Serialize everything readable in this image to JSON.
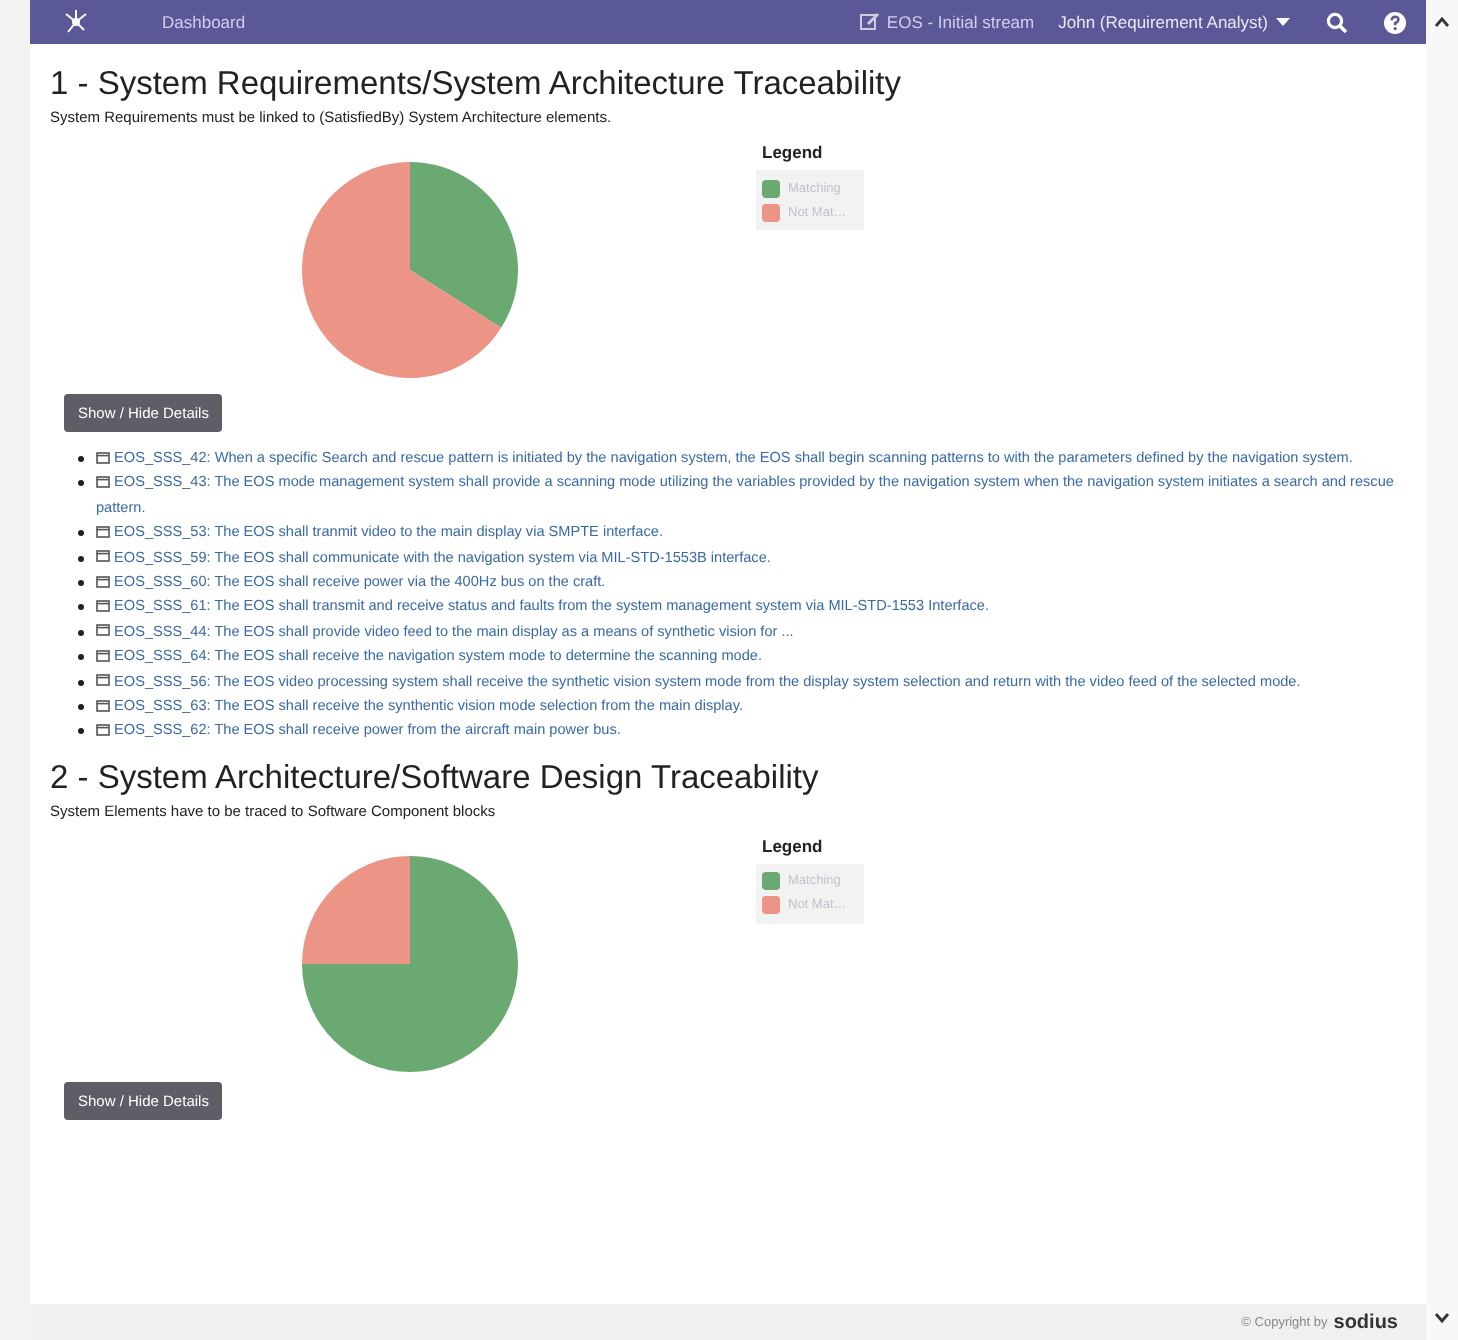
{
  "header": {
    "title": "Dashboard",
    "stream": "EOS - Initial stream",
    "user": "John (Requirement Analyst)"
  },
  "sections": [
    {
      "title": "1 - System Requirements/System Architecture Traceability",
      "description": "System Requirements must be linked to (SatisfiedBy) System Architecture elements.",
      "legend": {
        "title": "Legend",
        "items": [
          {
            "label": "Matching",
            "color": "#6aaa72"
          },
          {
            "label": "Not Mat…",
            "color": "#ec9486"
          }
        ]
      },
      "button": "Show / Hide Details",
      "items": [
        {
          "text": "EOS_SSS_42: When a specific Search and rescue pattern is initiated by the navigation system, the EOS shall begin scanning patterns to with the parameters defined by the navigation system."
        },
        {
          "text": "EOS_SSS_43: The EOS mode management system shall provide a scanning mode utilizing the variables provided by the navigation system when the navigation system initiates a search and rescue pattern."
        },
        {
          "text": "EOS_SSS_53: The EOS shall tranmit video to the main display via SMPTE interface."
        },
        {
          "text": "EOS_SSS_59: The EOS shall communicate with the navigation system via MIL-STD-1553B interface."
        },
        {
          "text": "EOS_SSS_60: The EOS shall receive power via the 400Hz bus on the craft."
        },
        {
          "text": "EOS_SSS_61: The EOS shall transmit and receive status and faults from the system management system via MIL-STD-1553 Interface."
        },
        {
          "text": "EOS_SSS_44: The EOS shall provide video feed to the main display as a means of synthetic vision for ..."
        },
        {
          "text": "EOS_SSS_64: The EOS shall receive the navigation system mode to determine the scanning mode."
        },
        {
          "text": "EOS_SSS_56: The EOS video processing system shall receive the synthetic vision system mode from the display system selection and return with the video feed of the selected mode."
        },
        {
          "text": "EOS_SSS_63: The EOS shall receive the synthentic vision mode selection from the main display."
        },
        {
          "text": "EOS_SSS_62: The EOS shall receive power from the aircraft main power bus."
        }
      ]
    },
    {
      "title": "2 - System Architecture/Software Design Traceability",
      "description": "System Elements have to be traced to Software Component blocks",
      "legend": {
        "title": "Legend",
        "items": [
          {
            "label": "Matching",
            "color": "#6aaa72"
          },
          {
            "label": "Not Mat…",
            "color": "#ec9486"
          }
        ]
      },
      "button": "Show / Hide Details"
    }
  ],
  "footer": {
    "copyright": "© Copyright by",
    "brand": "sodius"
  }
}
